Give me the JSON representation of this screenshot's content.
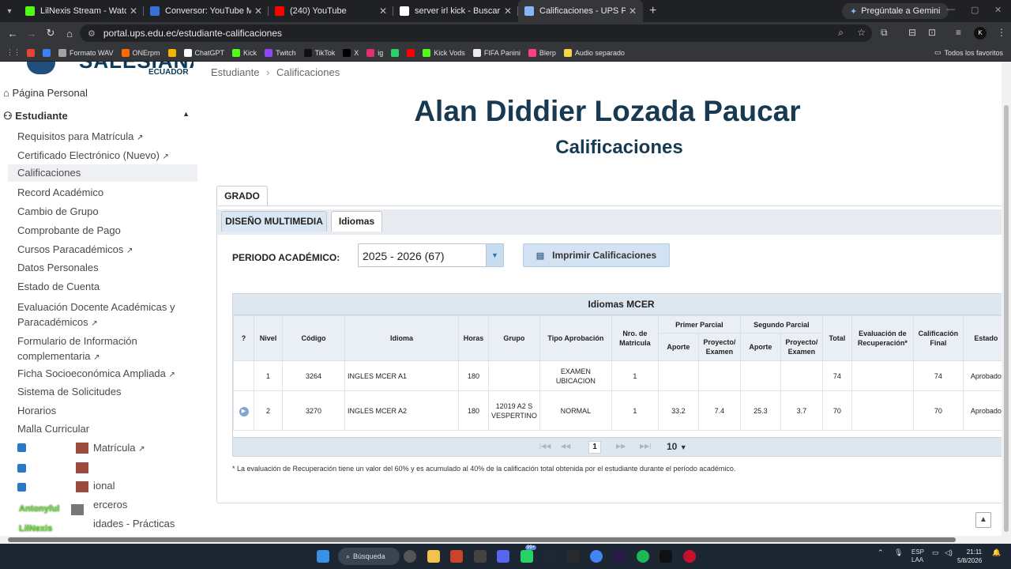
{
  "browser": {
    "tabs": [
      {
        "title": "LilNexis Stream - Watch Live on Kick",
        "color": "#53fc18"
      },
      {
        "title": "Conversor: YouTube MP3, TikTok",
        "color": "#3a6fd8"
      },
      {
        "title": "(240) YouTube",
        "color": "#ff0000"
      },
      {
        "title": "server irl kick - Buscar con Google",
        "color": "#ffffff"
      },
      {
        "title": "Calificaciones - UPS Privado",
        "color": "#8ab4f8"
      }
    ],
    "gemini_label": "Pregúntale a Gemini",
    "url": "portal.ups.edu.ec/estudiante-calificaciones",
    "bookmarks": [
      {
        "label": "",
        "color": "#ea4335"
      },
      {
        "label": "",
        "color": "#3b82f6"
      },
      {
        "label": "Formato WAV",
        "color": "#a3a3a3"
      },
      {
        "label": "ONErpm",
        "color": "#ff6a00"
      },
      {
        "label": "",
        "color": "#f4b400"
      },
      {
        "label": "ChatGPT",
        "color": "#ffffff"
      },
      {
        "label": "Kick",
        "color": "#53fc18"
      },
      {
        "label": "Twitch",
        "color": "#9146ff"
      },
      {
        "label": "TikTok",
        "color": "#111111"
      },
      {
        "label": "X",
        "color": "#000000"
      },
      {
        "label": "ig",
        "color": "#e1306c"
      },
      {
        "label": "",
        "color": "#25d366"
      },
      {
        "label": "",
        "color": "#ff0000"
      },
      {
        "label": "Kick Vods",
        "color": "#53fc18"
      },
      {
        "label": "FIFA Panini",
        "color": "#eeeeee"
      },
      {
        "label": "Blerp",
        "color": "#ff3d7f"
      },
      {
        "label": "Audio separado",
        "color": "#f7d44a"
      }
    ],
    "all_bookmarks": "Todos los favoritos"
  },
  "sidebar": {
    "logo_text": "SALESIANA",
    "logo_sub": "ECUADOR",
    "personal": "Página Personal",
    "section": "Estudiante",
    "items": [
      {
        "label": "Requisitos para Matrícula",
        "ext": true
      },
      {
        "label": "Certificado Electrónico (Nuevo)",
        "ext": true
      },
      {
        "label": "Calificaciones",
        "ext": false,
        "active": true
      },
      {
        "label": "Record Académico",
        "ext": false
      },
      {
        "label": "Cambio de Grupo",
        "ext": false
      },
      {
        "label": "Comprobante de Pago",
        "ext": false
      },
      {
        "label": "Cursos Paracadémicos",
        "ext": true
      },
      {
        "label": "Datos Personales",
        "ext": false
      },
      {
        "label": "Estado de Cuenta",
        "ext": false
      },
      {
        "label": "Evaluación Docente Académicas y",
        "label2": "Paracadémicos",
        "ext": true
      },
      {
        "label": "Formulario de Información",
        "label2": "complementaria",
        "ext": true
      },
      {
        "label": "Ficha Socioeconómica Ampliada",
        "ext": true
      },
      {
        "label": "Sistema de Solicitudes",
        "ext": false
      },
      {
        "label": "Horarios",
        "ext": false
      },
      {
        "label": "Malla Curricular",
        "ext": false
      }
    ],
    "partial_items": [
      "Matrícula",
      "ional",
      "erceros",
      "idades - Prácticas"
    ],
    "overlay_users": [
      "Antonyful",
      "LilNexis"
    ]
  },
  "main": {
    "breadcrumb": [
      "Estudiante",
      "Calificaciones"
    ],
    "student_name": "Alan Diddier Lozada Paucar",
    "page_title": "Calificaciones",
    "grado_tab": "GRADO",
    "subtabs": [
      "DISEÑO MULTIMEDIA",
      "Idiomas"
    ],
    "periodo_label": "PERIODO ACADÉMICO:",
    "periodo_value": "2025 - 2026 (67)",
    "print_label": "Imprimir Calificaciones",
    "grid": {
      "caption": "Idiomas MCER",
      "headers": {
        "q": "?",
        "nivel": "Nivel",
        "codigo": "Código",
        "idioma": "Idioma",
        "horas": "Horas",
        "grupo": "Grupo",
        "tipo": "Tipo Aprobación",
        "nro": "Nro. de Matricula",
        "primer": "Primer Parcial",
        "segundo": "Segundo Parcial",
        "aporte": "Aporte",
        "proyecto": "Proyecto/ Examen",
        "total": "Total",
        "recuperacion": "Evaluación de Recuperación*",
        "final": "Calificación Final",
        "estado": "Estado"
      },
      "rows": [
        {
          "info": false,
          "nivel": "1",
          "codigo": "3264",
          "idioma": "INGLES MCER A1",
          "horas": "180",
          "grupo": "",
          "tipo": "EXAMEN UBICACION",
          "nro": "1",
          "a1": "",
          "p1": "",
          "a2": "",
          "p2": "",
          "total": "74",
          "recuperacion": "",
          "final": "74",
          "estado": "Aprobado"
        },
        {
          "info": true,
          "nivel": "2",
          "codigo": "3270",
          "idioma": "INGLES MCER A2",
          "horas": "180",
          "grupo": "12019 A2 S VESPERTINO",
          "tipo": "NORMAL",
          "nro": "1",
          "a1": "33.2",
          "p1": "7.4",
          "a2": "25.3",
          "p2": "3.7",
          "total": "70",
          "recuperacion": "",
          "final": "70",
          "estado": "Aprobado"
        }
      ],
      "page": "1",
      "rows_per_page": "10"
    },
    "footnote": "* La evaluación de Recuperación tiene un valor del 60% y es acumulado al 40% de la calificación total obtenida por el estudiante durante el período académico."
  },
  "taskbar": {
    "search": "Búsqueda",
    "lang": "ESP",
    "lang2": "LAA",
    "time": "21:11",
    "date": "5/8/2026",
    "badge1": "99+"
  }
}
